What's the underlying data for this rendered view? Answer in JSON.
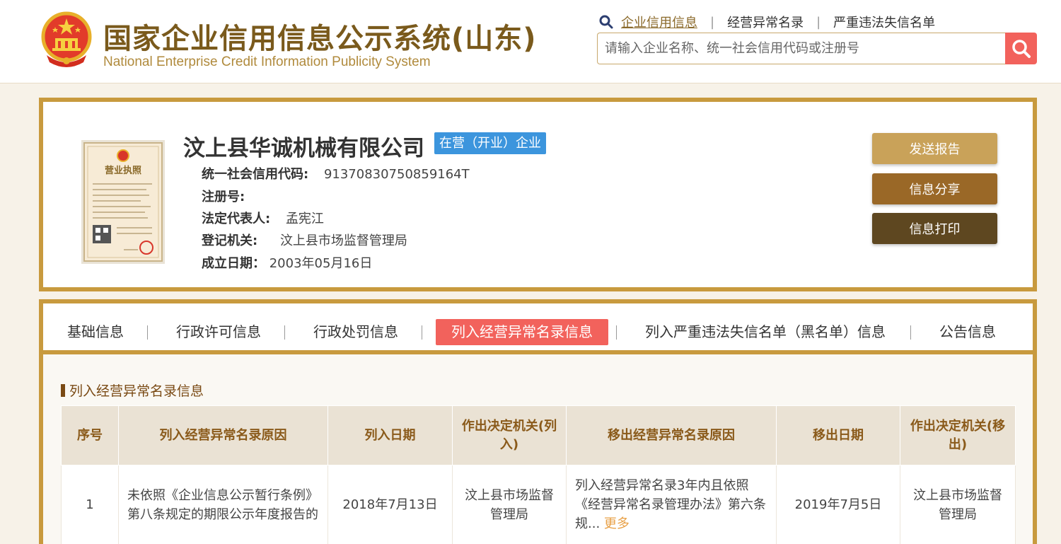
{
  "header": {
    "title_cn": "国家企业信用信息公示系统(山东)",
    "title_en": "National Enterprise Credit Information Publicity System",
    "top_links": [
      "企业信用信息",
      "经营异常名录",
      "严重违法失信名单"
    ],
    "search": {
      "placeholder": "请输入企业名称、统一社会信用代码或注册号"
    }
  },
  "company": {
    "name": "汶上县华诚机械有限公司",
    "status": "在营（开业）企业",
    "fields": [
      {
        "label": "统一社会信用代码:",
        "value": "91370830750859164T"
      },
      {
        "label": "注册号:",
        "value": ""
      },
      {
        "label": "法定代表人:",
        "value": "孟宪江"
      },
      {
        "label": "登记机关:",
        "value": "汶上县市场监督管理局"
      },
      {
        "label": "成立日期：",
        "value": "2003年05月16日"
      }
    ],
    "license_title": "营业执照",
    "actions": [
      {
        "label": "发送报告",
        "color": "#c9a259"
      },
      {
        "label": "信息分享",
        "color": "#9a6827"
      },
      {
        "label": "信息打印",
        "color": "#5e4720"
      }
    ]
  },
  "tabs": [
    "基础信息",
    "行政许可信息",
    "行政处罚信息",
    "列入经营异常名录信息",
    "列入严重违法失信名单（黑名单）信息",
    "公告信息"
  ],
  "active_tab": "列入经营异常名录信息",
  "section": {
    "title": "列入经营异常名录信息",
    "columns": [
      "序号",
      "列入经营异常名录原因",
      "列入日期",
      "作出决定机关(列入)",
      "移出经营异常名录原因",
      "移出日期",
      "作出决定机关(移出)"
    ],
    "rows": [
      {
        "index": "1",
        "reason_in": "未依照《企业信息公示暂行条例》第八条规定的期限公示年度报告的",
        "date_in": "2018年7月13日",
        "authority_in": "汶上县市场监督管理局",
        "reason_out": "列入经营异常名录3年内且依照《经营异常名录管理办法》第六条规...",
        "more": "更多",
        "date_out": "2019年7月5日",
        "authority_out": "汶上县市场监督管理局"
      }
    ]
  },
  "colors": {
    "gold": "#c89a3e",
    "brown": "#7a4a14",
    "accent_red": "#f2625c",
    "badge_blue": "#3c95dd"
  }
}
